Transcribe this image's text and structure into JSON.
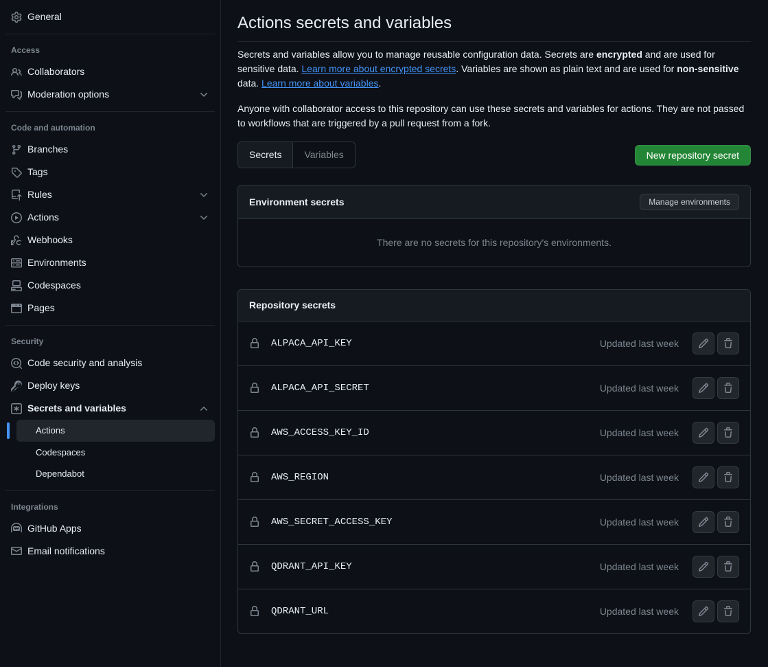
{
  "sidebar": {
    "general": "General",
    "sections": {
      "access": {
        "header": "Access",
        "collaborators": "Collaborators",
        "moderation": "Moderation options"
      },
      "code": {
        "header": "Code and automation",
        "branches": "Branches",
        "tags": "Tags",
        "rules": "Rules",
        "actions": "Actions",
        "webhooks": "Webhooks",
        "environments": "Environments",
        "codespaces": "Codespaces",
        "pages": "Pages"
      },
      "security": {
        "header": "Security",
        "code_security": "Code security and analysis",
        "deploy_keys": "Deploy keys",
        "secrets_variables": "Secrets and variables",
        "sub_actions": "Actions",
        "sub_codespaces": "Codespaces",
        "sub_dependabot": "Dependabot"
      },
      "integrations": {
        "header": "Integrations",
        "github_apps": "GitHub Apps",
        "email_notifications": "Email notifications"
      }
    }
  },
  "page": {
    "title": "Actions secrets and variables",
    "intro1_a": "Secrets and variables allow you to manage reusable configuration data. Secrets are ",
    "intro1_b": "encrypted",
    "intro1_c": " and are used for sensitive data. ",
    "intro1_link1": "Learn more about encrypted secrets",
    "intro1_d": ". Variables are shown as plain text and are used for ",
    "intro1_e": "non-sensitive",
    "intro1_f": " data. ",
    "intro1_link2": "Learn more about variables",
    "intro1_g": ".",
    "intro2": "Anyone with collaborator access to this repository can use these secrets and variables for actions. They are not passed to workflows that are triggered by a pull request from a fork.",
    "tab_secrets": "Secrets",
    "tab_variables": "Variables",
    "new_secret_btn": "New repository secret",
    "env_secrets_title": "Environment secrets",
    "manage_env_btn": "Manage environments",
    "env_empty": "There are no secrets for this repository's environments.",
    "repo_secrets_title": "Repository secrets"
  },
  "secrets": [
    {
      "name": "ALPACA_API_KEY",
      "updated": "Updated last week"
    },
    {
      "name": "ALPACA_API_SECRET",
      "updated": "Updated last week"
    },
    {
      "name": "AWS_ACCESS_KEY_ID",
      "updated": "Updated last week"
    },
    {
      "name": "AWS_REGION",
      "updated": "Updated last week"
    },
    {
      "name": "AWS_SECRET_ACCESS_KEY",
      "updated": "Updated last week"
    },
    {
      "name": "QDRANT_API_KEY",
      "updated": "Updated last week"
    },
    {
      "name": "QDRANT_URL",
      "updated": "Updated last week"
    }
  ]
}
